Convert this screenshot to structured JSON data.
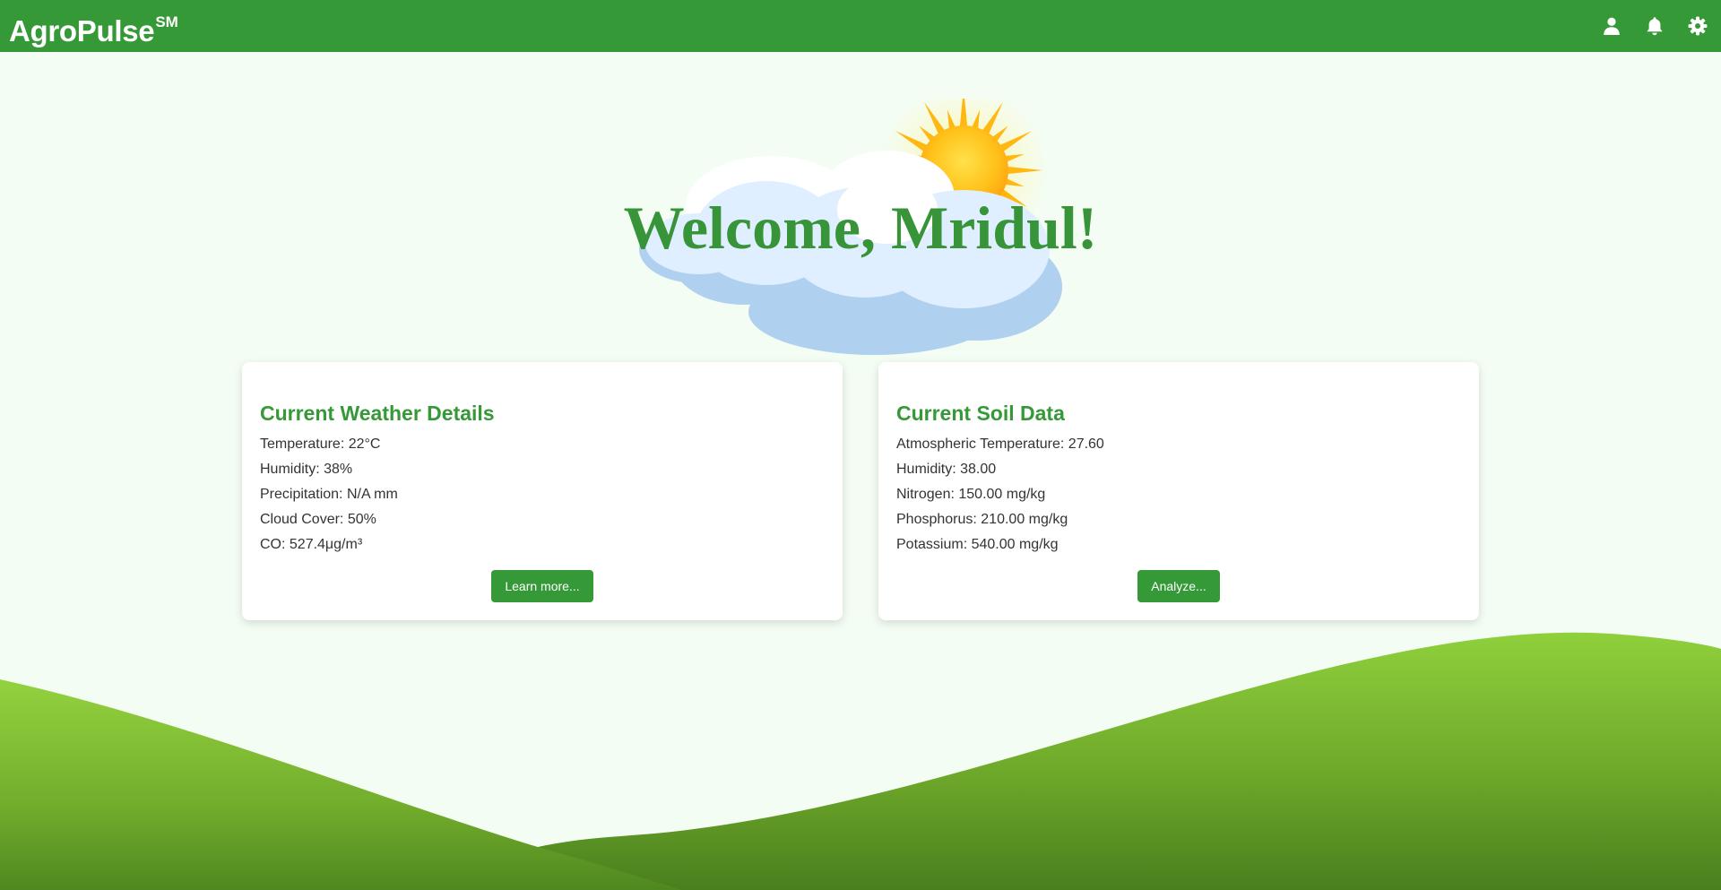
{
  "header": {
    "brand": "AgroPulse",
    "brand_mark": "SM",
    "icons": [
      "user-icon",
      "bell-icon",
      "gear-icon"
    ],
    "color": "#369937"
  },
  "hero": {
    "welcome_text": "Welcome, Mridul!",
    "illustration": [
      "sun-icon",
      "cloud-icon"
    ]
  },
  "weather_card": {
    "title": "Current Weather Details",
    "lines": [
      "Temperature: 22°C",
      "Humidity: 38%",
      "Precipitation: N/A mm",
      "Cloud Cover: 50%",
      "CO: 527.4μg/m³"
    ],
    "button_label": "Learn more..."
  },
  "soil_card": {
    "title": "Current Soil Data",
    "lines": [
      "Atmospheric Temperature: 27.60",
      "Humidity: 38.00",
      "Nitrogen: 150.00 mg/kg",
      "Phosphorus: 210.00 mg/kg",
      "Potassium: 540.00 mg/kg"
    ],
    "button_label": "Analyze..."
  },
  "colors": {
    "accent": "#369937",
    "background": "#f4fdf4",
    "hill_light": "#8ecf3a",
    "hill_dark": "#4e861f",
    "cloud": "#b0d0f0",
    "sun": "#ffc21a"
  }
}
